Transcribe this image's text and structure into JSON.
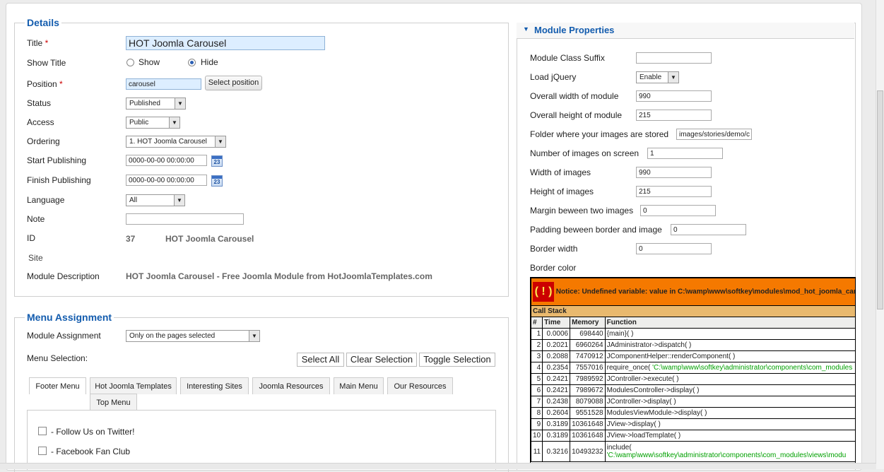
{
  "details": {
    "legend": "Details",
    "title_label": "Title",
    "required": "*",
    "title_value": "HOT Joomla Carousel",
    "show_title_label": "Show Title",
    "show_option": "Show",
    "hide_option": "Hide",
    "position_label": "Position",
    "position_value": "carousel",
    "select_position_btn": "Select position",
    "status_label": "Status",
    "status_value": "Published",
    "access_label": "Access",
    "access_value": "Public",
    "ordering_label": "Ordering",
    "ordering_value": "1. HOT Joomla Carousel",
    "start_label": "Start Publishing",
    "start_value": "0000-00-00 00:00:00",
    "finish_label": "Finish Publishing",
    "finish_value": "0000-00-00 00:00:00",
    "calendar_text": "23",
    "language_label": "Language",
    "language_value": "All",
    "note_label": "Note",
    "note_value": "",
    "id_label": "ID",
    "id_value": "37",
    "id_name": "HOT Joomla Carousel",
    "site_label": "Site",
    "desc_label": "Module Description",
    "desc_value": "HOT Joomla Carousel - Free Joomla Module from HotJoomlaTemplates.com"
  },
  "menu": {
    "legend": "Menu Assignment",
    "assignment_label": "Module Assignment",
    "assignment_value": "Only on the pages selected",
    "selection_label": "Menu Selection:",
    "select_all": "Select All",
    "clear_selection": "Clear Selection",
    "toggle_selection": "Toggle Selection",
    "tabs": [
      "Footer Menu",
      "Hot Joomla Templates",
      "Interesting Sites",
      "Joomla Resources",
      "Main Menu",
      "Our Resources",
      "Top Menu"
    ],
    "items": [
      "- Follow Us on Twitter!",
      "- Facebook Fan Club"
    ]
  },
  "props": {
    "header": "Module Properties",
    "class_suffix_label": "Module Class Suffix",
    "class_suffix_value": "",
    "load_jquery_label": "Load jQuery",
    "load_jquery_value": "Enable",
    "width_module_label": "Overall width of module",
    "width_module_value": "990",
    "height_module_label": "Overall height of module",
    "height_module_value": "215",
    "folder_label": "Folder where your images are stored",
    "folder_value": "images/stories/demo/c",
    "num_images_label": "Number of images on screen",
    "num_images_value": "1",
    "width_images_label": "Width of images",
    "width_images_value": "990",
    "height_images_label": "Height of images",
    "height_images_value": "215",
    "margin_label": "Margin beween two images",
    "margin_value": "0",
    "padding_label": "Padding beween border and image",
    "padding_value": "0",
    "border_width_label": "Border width",
    "border_width_value": "0",
    "border_color_label": "Border color"
  },
  "error": {
    "icon": "( ! )",
    "notice": "Notice: Undefined variable: value in C:\\wamp\\www\\softkey\\modules\\mod_hot_joomla_carousel",
    "call_stack": "Call Stack",
    "headers": [
      "#",
      "Time",
      "Memory",
      "Function"
    ],
    "rows": [
      {
        "n": "1",
        "t": "0.0006",
        "m": "698440",
        "f": "{main}( )",
        "p": ""
      },
      {
        "n": "2",
        "t": "0.2021",
        "m": "6960264",
        "f": "JAdministrator->dispatch( )",
        "p": ""
      },
      {
        "n": "3",
        "t": "0.2088",
        "m": "7470912",
        "f": "JComponentHelper::renderComponent( )",
        "p": ""
      },
      {
        "n": "4",
        "t": "0.2354",
        "m": "7557016",
        "f": "require_once( ",
        "p": "'C:\\wamp\\www\\softkey\\administrator\\components\\com_modules"
      },
      {
        "n": "5",
        "t": "0.2421",
        "m": "7989592",
        "f": "JController->execute( )",
        "p": ""
      },
      {
        "n": "6",
        "t": "0.2421",
        "m": "7989672",
        "f": "ModulesController->display( )",
        "p": ""
      },
      {
        "n": "7",
        "t": "0.2438",
        "m": "8079088",
        "f": "JController->display( )",
        "p": ""
      },
      {
        "n": "8",
        "t": "0.2604",
        "m": "9551528",
        "f": "ModulesViewModule->display( )",
        "p": ""
      },
      {
        "n": "9",
        "t": "0.3189",
        "m": "10361648",
        "f": "JView->display( )",
        "p": ""
      },
      {
        "n": "10",
        "t": "0.3189",
        "m": "10361648",
        "f": "JView->loadTemplate( )",
        "p": ""
      },
      {
        "n": "11",
        "t": "0.3216",
        "m": "10493232",
        "f": "include(",
        "p": "'C:\\wamp\\www\\softkey\\administrator\\components\\com_modules\\views\\modu"
      }
    ]
  }
}
